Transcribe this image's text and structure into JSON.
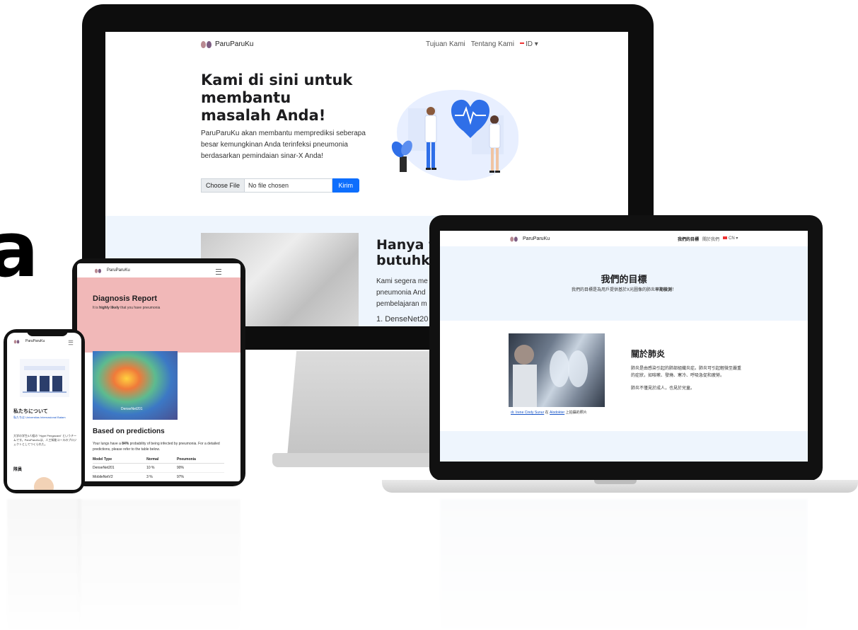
{
  "background": {
    "letter": "a"
  },
  "desktop": {
    "nav": {
      "brand": "ParuParuKu",
      "link1": "Tujuan Kami",
      "link2": "Tentang Kami",
      "lang": "ID"
    },
    "hero": {
      "title": "Kami di sini untuk membantu masalah Anda!",
      "text": "ParuParuKu akan membantu memprediksi seberapa besar kemungkinan Anda terinfeksi pneumonia berdasarkan pemindaian sinar-X Anda!",
      "file_button": "Choose File",
      "file_status": "No file chosen",
      "submit": "Kirim"
    },
    "section2": {
      "title_line1": "Hanya f",
      "title_line2": "butuhka",
      "text_line1": "Kami segera me",
      "text_line2": "pneumonia And",
      "text_line3": "pembelajaran m",
      "list_item": "1. DenseNet20"
    }
  },
  "laptop": {
    "nav": {
      "brand": "ParuParuKu",
      "link1": "我們的目標",
      "link2": "關於我們",
      "lang": "CN"
    },
    "goal_title": "我們的目標",
    "goal_sub_before": "我們的目標是為用戶提供基於X光圖像的肺炎",
    "goal_sub_bold": "早期檢測",
    "goal_sub_after": "！",
    "about_title": "關於肺炎",
    "about_p1": "肺炎是由感染引起的肺部組織炎症。肺炎可引起輕微至嚴重的症狀，如咳嗽、發燒、寒冷、呼吸急促和疲勞。",
    "about_p2": "肺炎不僅見於成人，也見於兒童。",
    "caption_link": "dr. Irene Cindy Sunur",
    "caption_mid": "在",
    "caption_link2": "Alodokter",
    "caption_end": "上拍攝的照片"
  },
  "tablet": {
    "nav": {
      "brand": "ParuParuKu"
    },
    "title": "Diagnosis Report",
    "sub_before": "It is ",
    "sub_bold": "highly likely",
    "sub_after": " that you have pneumonia",
    "heatmap_label": "DenseNet201",
    "section_title": "Based on predictions",
    "text_before": "Your lungs have a ",
    "text_bold": "84%",
    "text_after": " probability of being infected by pneumonia. For a detailed predictions, please refer to the table below.",
    "table": {
      "headers": [
        "Model Type",
        "Normal",
        "Pneumonia"
      ],
      "rows": [
        [
          "DenseNet201",
          "10 %",
          "90%"
        ],
        [
          "MobileNetV2",
          "3 %",
          "97%"
        ]
      ]
    }
  },
  "phone": {
    "nav": {
      "brand": "ParuParuKu"
    },
    "section_title": "私たちについて",
    "link_text": "私たちは Universitas Internasional Batam",
    "text": "大学の学生4人組の \"Hype Pengacara\" というチームです。ParuParuKuは、人工知能コースのプロジェクトとしてつくられた。",
    "members_title": "隊員"
  }
}
